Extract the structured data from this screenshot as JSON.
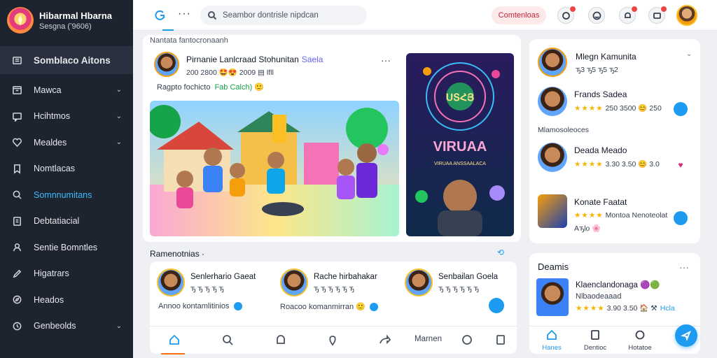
{
  "brand": {
    "title": "Hibarmal Hbarna",
    "subtitle": "Sesgna (ʼ9606)"
  },
  "sidebar": {
    "items": [
      {
        "label": "Somblaco Aitons",
        "icon": "grid-icon",
        "header": true
      },
      {
        "label": "Mawca",
        "icon": "calendar-icon",
        "chevron": true
      },
      {
        "label": "Hcihtmos",
        "icon": "chat-icon",
        "chevron": true
      },
      {
        "label": "Mealdes",
        "icon": "heart-icon",
        "chevron": true
      },
      {
        "label": "Nomtlacas",
        "icon": "bookmark-icon"
      },
      {
        "label": "Somnnumitans",
        "icon": "search-icon",
        "active": true
      },
      {
        "label": "Debtatiacial",
        "icon": "document-icon"
      },
      {
        "label": "Sentie Bomntles",
        "icon": "people-icon"
      },
      {
        "label": "Higatrars",
        "icon": "pen-icon"
      },
      {
        "label": "Heados",
        "icon": "compass-icon"
      },
      {
        "label": "Genbeolds",
        "icon": "clock-icon",
        "chevron": true
      }
    ]
  },
  "topbar": {
    "search_placeholder": "Seambor dontrisle nipdcan",
    "cta_label": "Comtenloas"
  },
  "feed": {
    "section_caption": "Nantata fantocronaanh",
    "post": {
      "title": "Pirnanie Lanlcraad Stohunitan",
      "title_accent": "Saela",
      "meta": "200 2800 🤩😍 2009 ▤ lfll",
      "caption": "Ragpto fochicto",
      "caption_tag": "Fab Calch) 🙂"
    },
    "promo": {
      "line1": "ՍՏՀՅ",
      "line2": "VIRUAA",
      "line3": "VIRUAA ANSSAALACA"
    }
  },
  "stories": {
    "label": "Ramenotnias ·",
    "link_icon": "refresh-icon",
    "items": [
      {
        "name": "Senlerhario Gaeat",
        "meta": "ꚋ ꚋ ꚋ ꚋ ꚋ"
      },
      {
        "name": "Rache hirbahakar",
        "meta": "ꚋ ꚋ ꚋ ꚋ ꚋ ꚋ"
      },
      {
        "name": "Senbailan Goela",
        "meta": "ꚋ ꚋ ꚋ ꚋ ꚋ ꚋ"
      }
    ],
    "status_left": "Annoo kontamlitinios",
    "status_right": "Roacoo komanmirran 🙂"
  },
  "tabbar": {
    "text_label": "Marnen"
  },
  "suggest": {
    "header_name": "Mlegn Kamunita",
    "header_meta": "ꚋ3 ꚋ5 ꚋ5 ꚋ2",
    "section_label": "Mlamosoleoces",
    "items": [
      {
        "name": "Frands Sadea",
        "rating": "★★★★",
        "meta": "250 3500 😊 250"
      },
      {
        "name": "Deada Meado",
        "rating": "★★★★",
        "meta": "3.30 3.50 😊 3.0"
      },
      {
        "name": "Konate Faatat",
        "rating": "★★★★",
        "meta": "Montoa Nenoteolat",
        "extra": "Aꚋlo 🌸"
      }
    ]
  },
  "events": {
    "title": "Deamis",
    "line1": "Klaenclandonaga 🟣🟢",
    "line2": "Nlbaodeaaad",
    "rating": "★★★★",
    "line3": "3.90 3.50 🏠 ⚒",
    "line3_accent": "Hcla",
    "tabs": [
      "Hanes",
      "Dentioc",
      "Hotatoe"
    ]
  },
  "colors": {
    "accent": "#1d9bf0",
    "sidebar_bg": "#1e2330",
    "cta": "#c2253a"
  }
}
